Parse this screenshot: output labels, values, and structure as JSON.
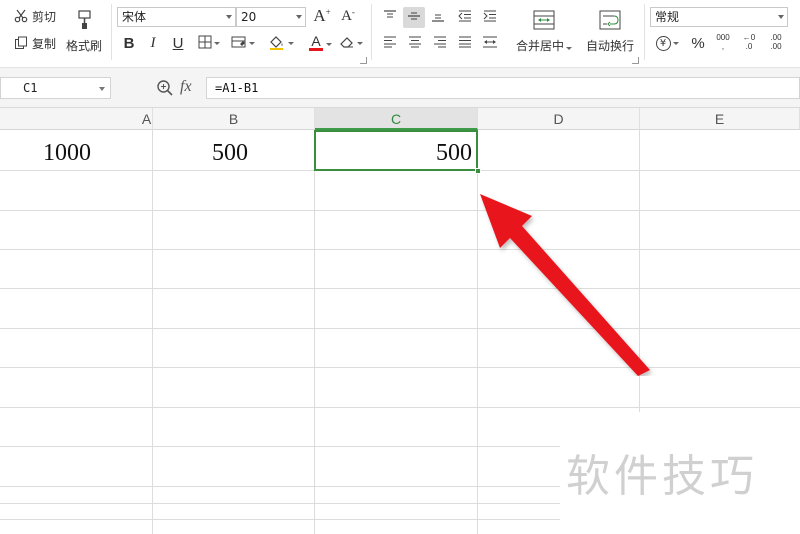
{
  "ribbon": {
    "clipboard": {
      "cut_label": "剪切",
      "copy_label": "复制",
      "format_painter_label": "格式刷"
    },
    "font": {
      "name": "宋体",
      "size": "20",
      "bold": "B",
      "italic": "I",
      "underline": "U",
      "grow_glyph": "A",
      "shrink_glyph": "A",
      "font_color_glyph": "A"
    },
    "alignment": {
      "merge_center_label": "合并居中",
      "wrap_text_label": "自动换行"
    },
    "number": {
      "format": "常规",
      "currency_glyph": "¥",
      "percent_glyph": "%",
      "thousands_glyph": "000",
      "inc_decimal_glyph": ".0",
      "dec_decimal_glyph": ".00"
    }
  },
  "formula_bar": {
    "name_box": "C1",
    "zoom_icon_glyph": "⊕",
    "fx_label": "fx",
    "formula": "=A1-B1"
  },
  "grid": {
    "columns": [
      "A",
      "B",
      "C",
      "D",
      "E"
    ],
    "selected_column": "C",
    "rows": [
      {
        "A": "1000",
        "B": "500",
        "C": "500"
      }
    ]
  },
  "watermark": "软件技巧",
  "colors": {
    "selection_green": "#3a8f3f",
    "arrow_red": "#e8151b"
  }
}
